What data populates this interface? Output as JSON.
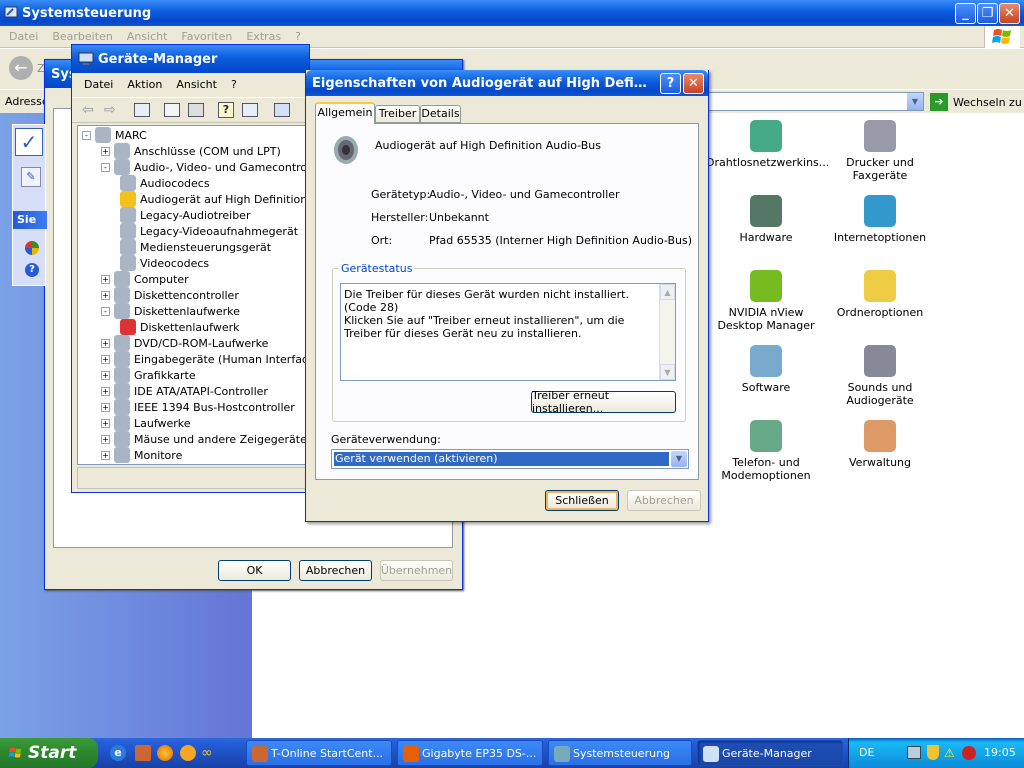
{
  "cp_window": {
    "title": "Systemsteuerung",
    "menu": [
      "Datei",
      "Bearbeiten",
      "Ansicht",
      "Favoriten",
      "Extras",
      "?"
    ],
    "address_label": "Adresse",
    "go_label": "Wechseln zu",
    "back_partial": "Z"
  },
  "cp_items": [
    {
      "label": "Drahtlosnetzwerkins...",
      "icon": "wireless-icon"
    },
    {
      "label": "Drucker und Faxgeräte",
      "icon": "printer-icon"
    },
    {
      "label": "Hardware",
      "icon": "hardware-icon"
    },
    {
      "label": "Internetoptionen",
      "icon": "globe-icon"
    },
    {
      "label": "NVIDIA nView Desktop Manager",
      "icon": "nvidia-icon"
    },
    {
      "label": "Ordneroptionen",
      "icon": "folder-icon"
    },
    {
      "label": "Software",
      "icon": "cd-icon"
    },
    {
      "label": "Sounds und Audiogeräte",
      "icon": "speaker-icon"
    },
    {
      "label": "Telefon- und Modemoptionen",
      "icon": "phone-icon"
    },
    {
      "label": "Verwaltung",
      "icon": "tools-icon"
    }
  ],
  "sys_window": {
    "title_partial": "Sys",
    "sidebar_partial": "Sie",
    "ok": "OK",
    "abbrechen": "Abbrechen",
    "uebernehmen": "Übernehmen"
  },
  "device_manager": {
    "title": "Geräte-Manager",
    "menu": [
      "Datei",
      "Aktion",
      "Ansicht",
      "?"
    ],
    "tree": [
      {
        "label": "MARC",
        "level": 0,
        "exp": "-"
      },
      {
        "label": "Anschlüsse (COM und LPT)",
        "level": 1,
        "exp": "+"
      },
      {
        "label": "Audio-, Video- und Gamecontroller",
        "level": 1,
        "exp": "-"
      },
      {
        "label": "Audiocodecs",
        "level": 2,
        "exp": ""
      },
      {
        "label": "Audiogerät auf High Definition A",
        "level": 2,
        "exp": "",
        "warn": true
      },
      {
        "label": "Legacy-Audiotreiber",
        "level": 2,
        "exp": ""
      },
      {
        "label": "Legacy-Videoaufnahmegerät",
        "level": 2,
        "exp": ""
      },
      {
        "label": "Mediensteuerungsgerät",
        "level": 2,
        "exp": ""
      },
      {
        "label": "Videocodecs",
        "level": 2,
        "exp": ""
      },
      {
        "label": "Computer",
        "level": 1,
        "exp": "+"
      },
      {
        "label": "Diskettencontroller",
        "level": 1,
        "exp": "+"
      },
      {
        "label": "Diskettenlaufwerke",
        "level": 1,
        "exp": "-"
      },
      {
        "label": "Diskettenlaufwerk",
        "level": 2,
        "exp": "",
        "err": true
      },
      {
        "label": "DVD/CD-ROM-Laufwerke",
        "level": 1,
        "exp": "+"
      },
      {
        "label": "Eingabegeräte (Human Interface De",
        "level": 1,
        "exp": "+"
      },
      {
        "label": "Grafikkarte",
        "level": 1,
        "exp": "+"
      },
      {
        "label": "IDE ATA/ATAPI-Controller",
        "level": 1,
        "exp": "+"
      },
      {
        "label": "IEEE 1394 Bus-Hostcontroller",
        "level": 1,
        "exp": "+"
      },
      {
        "label": "Laufwerke",
        "level": 1,
        "exp": "+"
      },
      {
        "label": "Mäuse und andere Zeigegeräte",
        "level": 1,
        "exp": "+"
      },
      {
        "label": "Monitore",
        "level": 1,
        "exp": "+"
      }
    ]
  },
  "props": {
    "title": "Eigenschaften von Audiogerät auf High Definition Au...",
    "tabs": [
      "Allgemein",
      "Treiber",
      "Details"
    ],
    "device_name": "Audiogerät auf High Definition Audio-Bus",
    "rows": [
      {
        "label": "Gerätetyp:",
        "value": "Audio-, Video- und Gamecontroller"
      },
      {
        "label": "Hersteller:",
        "value": "Unbekannt"
      },
      {
        "label": "Ort:",
        "value": "Pfad 65535 (Interner High Definition Audio-Bus)"
      }
    ],
    "status_group": "Gerätestatus",
    "status_line1": "Die Treiber für dieses Gerät wurden nicht installiert. (Code 28)",
    "status_line2": "Klicken Sie auf \"Treiber erneut installieren\", um die Treiber für dieses Gerät neu zu installieren.",
    "reinstall": "Treiber erneut installieren...",
    "usage_label": "Geräteverwendung:",
    "usage_value": "Gerät verwenden (aktivieren)",
    "close": "Schließen",
    "cancel": "Abbrechen"
  },
  "taskbar": {
    "start": "Start",
    "buttons": [
      "T-Online StartCent...",
      "Gigabyte EP35 DS-...",
      "Systemsteuerung",
      "Geräte-Manager"
    ],
    "lang": "DE",
    "clock": "19:05"
  }
}
